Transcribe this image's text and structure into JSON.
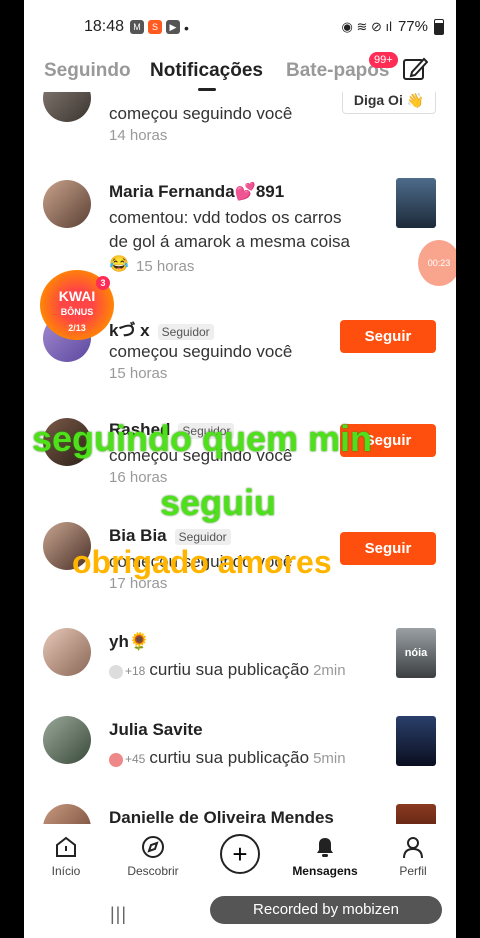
{
  "status": {
    "time": "18:48",
    "dot": "•",
    "battery": "77%",
    "apps": [
      "M",
      "S",
      "▶"
    ],
    "right_icons": "◉ ≋ ⊘ ıl"
  },
  "tabs": {
    "following": "Seguindo",
    "notifications": "Notificações",
    "chats": "Bate-papos",
    "badge": "99+"
  },
  "items": [
    {
      "line": "começou seguindo você",
      "time": "14 horas",
      "button": "Diga Oi 👋"
    },
    {
      "name": "Maria Fernanda💕891",
      "line1": "comentou: vdd todos os carros",
      "line2": "de gol á amarok a mesma coisa",
      "time": "15 horas",
      "emoji": "😂"
    },
    {
      "name": "kづ  x",
      "tag": "Seguidor",
      "line": "começou seguindo você",
      "time": "15 horas",
      "button": "Seguir"
    },
    {
      "name": "Rashed",
      "tag": "Seguidor",
      "line": "começou seguindo você",
      "time": "16 horas",
      "button": "Seguir"
    },
    {
      "name": "Bia Bia",
      "tag": "Seguidor",
      "line": "começou seguindo você",
      "time": "17 horas",
      "button": "Seguir"
    },
    {
      "name": "yh🌻",
      "likers": "+18",
      "line": "curtiu sua publicação",
      "time": "2min",
      "thumb_text": "nóia"
    },
    {
      "name": "Julia Savite",
      "likers": "+45",
      "line": "curtiu sua publicação",
      "time": "5min"
    },
    {
      "name": "Danielle de Oliveira Mendes"
    }
  ],
  "overlays": {
    "green1": "seguindo quem min",
    "green2": "seguiu",
    "orange": "obrigado amores"
  },
  "kwai": {
    "title": "KWAI",
    "sub": "BÔNUS",
    "count": "3",
    "progress": "2/13"
  },
  "mobizen_bubble": "00:23",
  "nav": {
    "home": "Início",
    "discover": "Descobrir",
    "messages": "Mensagens",
    "profile": "Perfil"
  },
  "recorded": "Recorded by mobizen",
  "sys_recent": "|||"
}
